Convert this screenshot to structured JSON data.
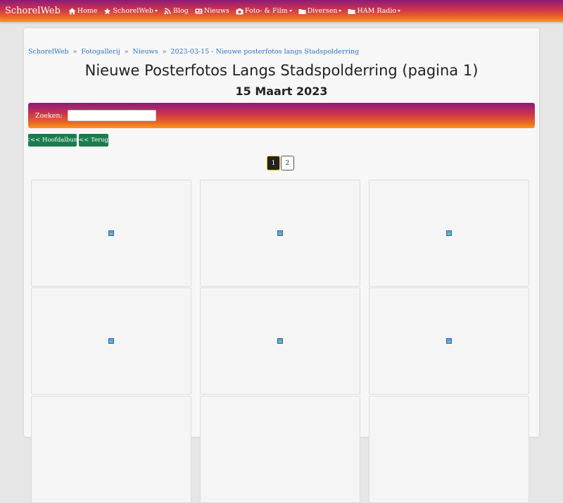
{
  "nav": {
    "brand": "SchorelWeb",
    "items": [
      {
        "label": "Home",
        "icon": "home-icon",
        "dropdown": false
      },
      {
        "label": "SchorelWeb",
        "icon": "star-icon",
        "dropdown": true
      },
      {
        "label": "Blog",
        "icon": "rss-icon",
        "dropdown": false
      },
      {
        "label": "Nieuws",
        "icon": "newspaper-icon",
        "dropdown": false
      },
      {
        "label": "Foto- & Film",
        "icon": "camera-icon",
        "dropdown": true
      },
      {
        "label": "Diversen",
        "icon": "folder-icon",
        "dropdown": true
      },
      {
        "label": "HAM Radio",
        "icon": "folder-icon",
        "dropdown": true
      }
    ]
  },
  "breadcrumb": [
    "SchorelWeb",
    "Fotogallerij",
    "Nieuws",
    "2023-03-15 - Nieuwe posterfotos langs Stadspolderring"
  ],
  "breadcrumb_sep": "»",
  "title": "Nieuwe Posterfotos Langs Stadspolderring (pagina 1)",
  "subtitle": "15 Maart 2023",
  "search": {
    "label": "Zoeken:",
    "value": ""
  },
  "buttons": {
    "main_album": "<<< Hoofdalbum",
    "back": "<< Terug"
  },
  "pagination": {
    "pages": [
      "1",
      "2"
    ],
    "current": "1"
  },
  "gallery": {
    "tile_count": 9,
    "icon": "broken-image-icon"
  },
  "colors": {
    "accent_purple": "#8b1a7a",
    "accent_orange": "#f59a1c",
    "button_green": "#1b7c4e",
    "link": "#2b74c7"
  }
}
